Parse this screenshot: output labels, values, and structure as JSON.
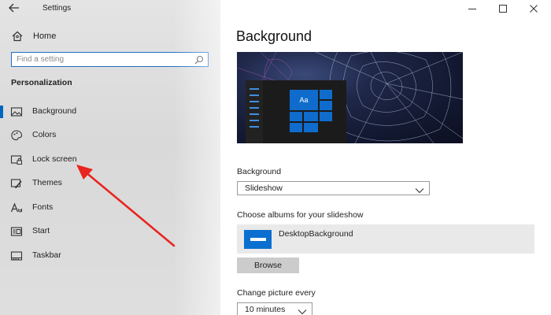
{
  "window": {
    "app_title": "Settings",
    "controls": [
      "minimize",
      "maximize",
      "close"
    ]
  },
  "sidebar": {
    "home_label": "Home",
    "search_placeholder": "Find a setting",
    "section_heading": "Personalization",
    "items": [
      {
        "label": "Background",
        "icon": "picture-icon",
        "selected": true
      },
      {
        "label": "Colors",
        "icon": "palette-icon",
        "selected": false
      },
      {
        "label": "Lock screen",
        "icon": "lock-screen-icon",
        "selected": false
      },
      {
        "label": "Themes",
        "icon": "brush-icon",
        "selected": false
      },
      {
        "label": "Fonts",
        "icon": "font-icon",
        "selected": false
      },
      {
        "label": "Start",
        "icon": "start-icon",
        "selected": false
      },
      {
        "label": "Taskbar",
        "icon": "taskbar-icon",
        "selected": false
      }
    ]
  },
  "main": {
    "title": "Background",
    "preview": {
      "tile_text": "Aa"
    },
    "background_label": "Background",
    "background_value": "Slideshow",
    "albums_label": "Choose albums for your slideshow",
    "album_name": "DesktopBackground",
    "browse_label": "Browse",
    "change_label": "Change picture every",
    "change_value": "10 minutes"
  },
  "colors": {
    "accent": "#0067c0",
    "annotation_arrow": "#e8251f"
  }
}
